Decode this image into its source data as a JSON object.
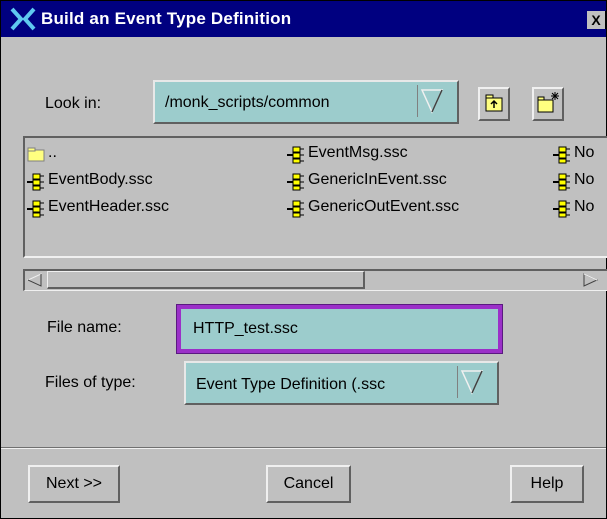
{
  "window": {
    "title": "Build an Event Type Definition",
    "close": "X"
  },
  "look_in": {
    "label": "Look in:",
    "value": "/monk_scripts/common"
  },
  "toolbar": {
    "up_icon": "up-folder-icon",
    "new_icon": "new-folder-icon"
  },
  "files": {
    "col1": [
      "..",
      "EventBody.ssc",
      "EventHeader.ssc"
    ],
    "col2": [
      "EventMsg.ssc",
      "GenericInEvent.ssc",
      "GenericOutEvent.ssc"
    ],
    "col3": [
      "No",
      "No",
      "No"
    ]
  },
  "file_name": {
    "label": "File name:",
    "value": "HTTP_test.ssc"
  },
  "file_type": {
    "label": "Files of type:",
    "value": "Event Type Definition (.ssc"
  },
  "buttons": {
    "next": "Next >>",
    "cancel": "Cancel",
    "help": "Help"
  },
  "colors": {
    "titlebar": "#000080",
    "field": "#9ccccc",
    "focus_ring": "#9b30c8",
    "dialog": "#c0c0c0"
  }
}
